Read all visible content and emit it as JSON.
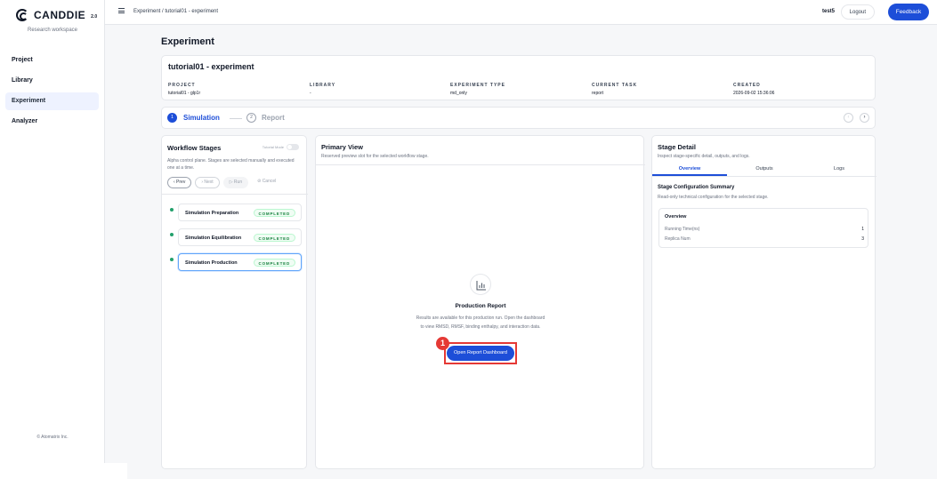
{
  "app": {
    "name": "CANDDIE",
    "version": "2.0",
    "workspace": "Research workspace",
    "copyright": "© Atomatrix Inc."
  },
  "sidebar": {
    "items": [
      {
        "label": "Project",
        "active": false
      },
      {
        "label": "Library",
        "active": false
      },
      {
        "label": "Experiment",
        "active": true
      },
      {
        "label": "Analyzer",
        "active": false
      }
    ]
  },
  "topbar": {
    "breadcrumb": "Experiment / tutorial01 - experiment",
    "user": "test5",
    "logout": "Logout",
    "feedback": "Feedback"
  },
  "page": {
    "title": "Experiment"
  },
  "experiment": {
    "name": "tutorial01 - experiment",
    "meta": [
      {
        "label": "PROJECT",
        "value": "tutorial01 - glp1r"
      },
      {
        "label": "LIBRARY",
        "value": "-"
      },
      {
        "label": "EXPERIMENT TYPE",
        "value": "md_only"
      },
      {
        "label": "CURRENT TASK",
        "value": "report"
      },
      {
        "label": "CREATED",
        "value": "2026-09-02 15:36:06"
      }
    ]
  },
  "steps": [
    {
      "num": "1",
      "label": "Simulation"
    },
    {
      "num": "2",
      "label": "Report"
    }
  ],
  "pager": {
    "prev": "‹",
    "next": "›"
  },
  "workflow": {
    "title": "Workflow Stages",
    "tutorial_label": "Tutorial Mode",
    "desc": "Alpha control plane. Stages are selected manually and executed one at a time.",
    "controls": {
      "prev": "‹ Prev",
      "next": "› Next",
      "run": "▷ Run",
      "cancel": "⊘ Cancel"
    },
    "stages": [
      {
        "name": "Simulation Preparation",
        "status": "COMPLETED"
      },
      {
        "name": "Simulation Equilibration",
        "status": "COMPLETED"
      },
      {
        "name": "Simulation Production",
        "status": "COMPLETED"
      }
    ]
  },
  "primary": {
    "title": "Primary View",
    "sub": "Reserved preview slot for the selected workflow stage.",
    "report_title": "Production Report",
    "report_desc": "Results are available for this production run. Open the dashboard to view RMSD, RMSF, binding enthalpy, and interaction data.",
    "button": "Open Report Dashboard",
    "callout": "1",
    "icon": "bar-chart-icon"
  },
  "detail": {
    "title": "Stage Detail",
    "sub": "Inspect stage-specific detail, outputs, and logs.",
    "tabs": [
      "Overview",
      "Outputs",
      "Logs"
    ],
    "cfg_title": "Stage Configuration Summary",
    "cfg_sub": "Read-only technical configuration for the selected stage.",
    "overview_title": "Overview",
    "rows": [
      {
        "label": "Running Time(ns)",
        "value": "1"
      },
      {
        "label": "Replica Num",
        "value": "3"
      }
    ]
  },
  "colors": {
    "accent": "#1d4ed8",
    "success": "#15803d",
    "callout": "#e53935"
  }
}
